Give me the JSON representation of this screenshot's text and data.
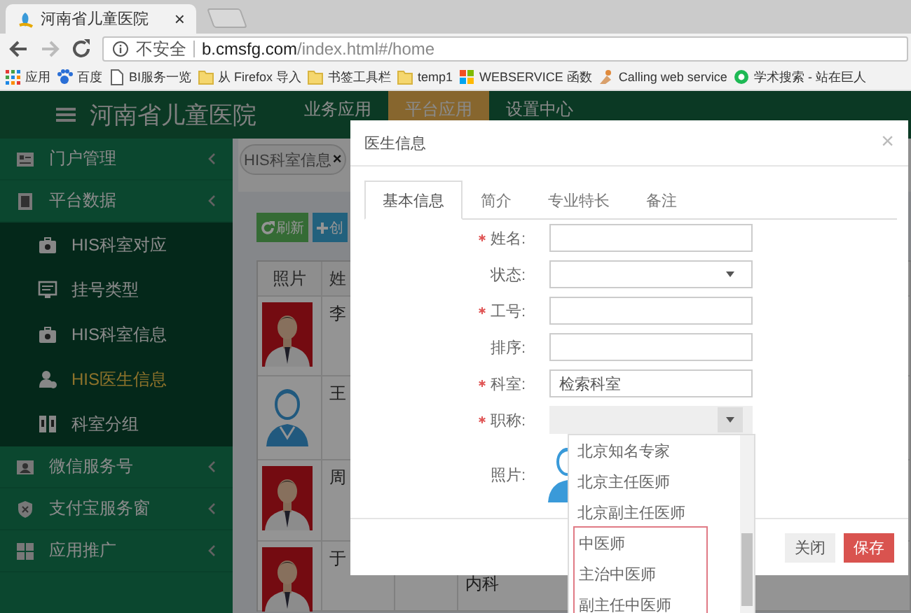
{
  "browser": {
    "tab": {
      "title": "河南省儿童医院",
      "close": "×"
    },
    "address": {
      "security": "不安全",
      "host": "b.cmsfg.com",
      "path": "/index.html#/home"
    },
    "bookmarks": [
      {
        "label": "应用",
        "kind": "apps"
      },
      {
        "label": "百度",
        "kind": "paw"
      },
      {
        "label": "BI服务一览",
        "kind": "page"
      },
      {
        "label": "从 Firefox 导入",
        "kind": "folder"
      },
      {
        "label": "书签工具栏",
        "kind": "folder"
      },
      {
        "label": "temp1",
        "kind": "folder"
      },
      {
        "label": "WEBSERVICE 函数",
        "kind": "tiles"
      },
      {
        "label": "Calling web service",
        "kind": "figure"
      },
      {
        "label": "学术搜索 - 站在巨人",
        "kind": "ring"
      }
    ]
  },
  "header": {
    "title": "河南省儿童医院",
    "nav": [
      {
        "label": "业务应用",
        "selected": false
      },
      {
        "label": "平台应用",
        "selected": true
      },
      {
        "label": "设置中心",
        "selected": false
      }
    ]
  },
  "sidebar": {
    "groups": [
      {
        "label": "门户管理"
      },
      {
        "label": "平台数据",
        "children": [
          {
            "label": "HIS科室对应",
            "selected": false
          },
          {
            "label": "挂号类型",
            "selected": false
          },
          {
            "label": "HIS科室信息",
            "selected": false
          },
          {
            "label": "HIS医生信息",
            "selected": true
          },
          {
            "label": "科室分组",
            "selected": false
          }
        ]
      },
      {
        "label": "微信服务号"
      },
      {
        "label": "支付宝服务窗"
      },
      {
        "label": "应用推广"
      }
    ]
  },
  "content": {
    "tab": {
      "label": "HIS科室信息",
      "close": "×"
    },
    "buttons": [
      {
        "label": "刷新",
        "kind": "refresh"
      },
      {
        "label": "创",
        "kind": "add"
      }
    ],
    "table": {
      "columns": [
        "照片",
        "姓"
      ],
      "rows": [
        {
          "name": "李"
        },
        {
          "photo": {
            "kind": "avatar"
          },
          "name": "王"
        },
        {
          "name": "周"
        },
        {
          "name": "于",
          "column_4": "内科"
        }
      ]
    }
  },
  "dialog": {
    "title": "医生信息",
    "close": "×",
    "tabs": [
      {
        "label": "基本信息",
        "selected": true
      },
      {
        "label": "简介",
        "selected": false
      },
      {
        "label": "专业特长",
        "selected": false
      },
      {
        "label": "备注",
        "selected": false
      }
    ],
    "fields": [
      {
        "label": "姓名:",
        "required": true,
        "kind": "text"
      },
      {
        "label": "状态:",
        "required": false,
        "kind": "select"
      },
      {
        "label": "工号:",
        "required": true,
        "kind": "text"
      },
      {
        "label": "排序:",
        "required": false,
        "kind": "text"
      },
      {
        "label": "科室:",
        "required": true,
        "kind": "text",
        "value": "检索科室"
      },
      {
        "label": "职称:",
        "required": true,
        "kind": "combo"
      },
      {
        "label": "照片:",
        "required": false
      }
    ],
    "dropdown": {
      "options": [
        {
          "label": "北京知名专家",
          "highlighted": false
        },
        {
          "label": "北京主任医师",
          "highlighted": false
        },
        {
          "label": "北京副主任医师",
          "highlighted": false
        },
        {
          "label": "中医师",
          "highlighted": true
        },
        {
          "label": "主治中医师",
          "highlighted": true
        },
        {
          "label": "副主任中医师",
          "highlighted": true
        }
      ]
    },
    "buttons": [
      {
        "label": "关闭",
        "kind": "default"
      },
      {
        "label": "保存",
        "kind": "primary"
      }
    ]
  }
}
